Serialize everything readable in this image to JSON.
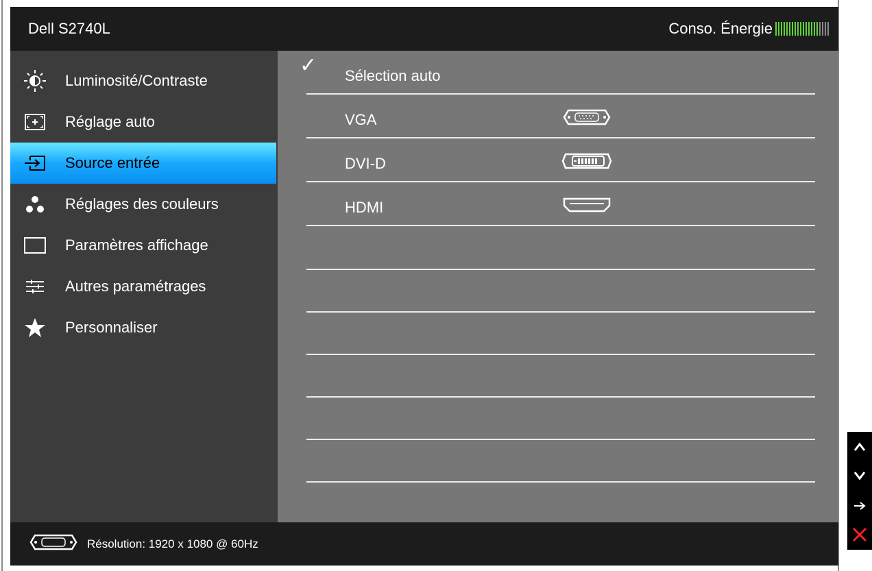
{
  "header": {
    "title": "Dell S2740L",
    "energy_label": "Conso. Énergie",
    "energy_level": 0.8,
    "energy_segments": 20,
    "energy_on_color": "#5fd23a",
    "energy_off_color": "#8a8a8a"
  },
  "sidebar": {
    "items": [
      {
        "label": "Luminosité/Contraste",
        "icon": "brightness-icon"
      },
      {
        "label": "Réglage auto",
        "icon": "auto-adjust-icon"
      },
      {
        "label": "Source entrée",
        "icon": "input-source-icon",
        "active": true
      },
      {
        "label": "Réglages des couleurs",
        "icon": "color-dots-icon"
      },
      {
        "label": "Paramètres affichage",
        "icon": "display-rectangle-icon"
      },
      {
        "label": "Autres paramétrages",
        "icon": "sliders-icon"
      },
      {
        "label": "Personnaliser",
        "icon": "star-icon"
      }
    ],
    "active_color": "#18a8ff"
  },
  "content": {
    "rows": [
      {
        "label": "Sélection auto",
        "checked": true
      },
      {
        "label": "VGA",
        "port_icon": "vga-port-icon"
      },
      {
        "label": "DVI-D",
        "port_icon": "dvi-port-icon"
      },
      {
        "label": "HDMI",
        "port_icon": "hdmi-port-icon"
      }
    ]
  },
  "footer": {
    "icon": "vga-port-icon",
    "resolution": "Résolution: 1920 x 1080 @ 60Hz"
  },
  "nav": {
    "buttons": [
      "up-arrow-icon",
      "down-arrow-icon",
      "right-arrow-icon",
      "close-x-icon"
    ],
    "close_color": "#ff2020"
  }
}
